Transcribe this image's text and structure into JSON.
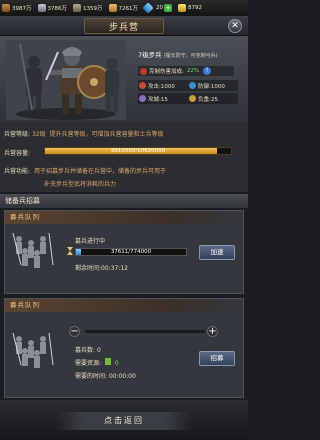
{
  "resources": [
    {
      "icon": "wood-icon",
      "value": "3987万"
    },
    {
      "icon": "iron-icon",
      "value": "3786万"
    },
    {
      "icon": "stone-icon",
      "value": "1359万"
    },
    {
      "icon": "food-icon",
      "value": "7261万"
    },
    {
      "icon": "gem-icon",
      "value": "20"
    },
    {
      "icon": "gold-icon",
      "value": "8792"
    }
  ],
  "header": {
    "title": "步兵营"
  },
  "unit": {
    "name": "7级步兵",
    "traits": "(擅长防守，可克制弓兵)",
    "counter_label": "克制伤害加成:",
    "counter_value": "22%",
    "stats": {
      "attack": "攻击:1000",
      "defense": "防御:1000",
      "siege": "攻城:15",
      "load": "负重:25"
    }
  },
  "barracks": {
    "level_label": "兵营等级:",
    "level_value": "32级",
    "level_desc": "提升兵营等级，可增加兵营容量和士兵等级",
    "capacity_label": "兵营容量:",
    "capacity_text": "9810000/10620000",
    "capacity_fraction": 0.9237,
    "function_label": "兵营功能:",
    "function_line1": "用于招募步兵并储备在兵营中，储备的步兵可用于",
    "function_line2": "补充步兵型武将消耗的兵力"
  },
  "reserve": {
    "title": "储备兵招募"
  },
  "queue1": {
    "title": "募兵队列",
    "status": "募兵进行中",
    "progress_text": "37611/774000",
    "progress_fraction": 0.0486,
    "remaining_label": "剩余时间:",
    "remaining_value": "00:37:12",
    "speedup_label": "加速"
  },
  "queue2": {
    "title": "募兵队列",
    "count_label": "募兵数:",
    "count_value": "0",
    "cost_label": "需要资源:",
    "cost_value": "0",
    "time_label": "需要的时间:",
    "time_value": "00:00:00",
    "recruit_label": "招募"
  },
  "footer": {
    "back_label": "点击返回"
  },
  "colors": {
    "accent_gold": "#f7c25a",
    "progress_blue": "#2b86c9",
    "bonus_green": "#6fe26f"
  }
}
